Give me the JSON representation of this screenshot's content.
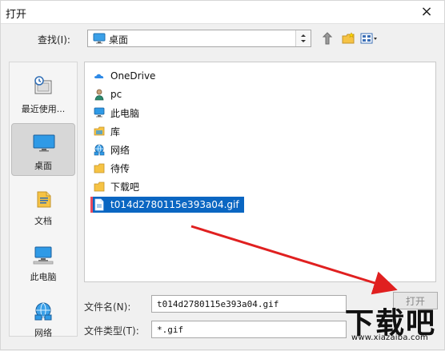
{
  "window": {
    "title": "打开",
    "close_glyph": "×"
  },
  "lookin": {
    "label": "查找(I):",
    "current": "桌面",
    "icon": "desktop-icon",
    "dropdown_icon": "chevron-updown-icon"
  },
  "toolbar": {
    "up_icon": "up-one-level-icon",
    "new_folder_icon": "new-folder-icon",
    "view_menu_icon": "view-menu-icon"
  },
  "sidebar": {
    "items": [
      {
        "label": "最近使用...",
        "icon": "recent-icon"
      },
      {
        "label": "桌面",
        "icon": "desktop-icon",
        "active": true
      },
      {
        "label": "文档",
        "icon": "documents-icon"
      },
      {
        "label": "此电脑",
        "icon": "this-pc-icon"
      },
      {
        "label": "网络",
        "icon": "network-icon"
      }
    ]
  },
  "filelist": {
    "items": [
      {
        "label": "OneDrive",
        "icon": "onedrive-icon"
      },
      {
        "label": "pc",
        "icon": "user-icon"
      },
      {
        "label": "此电脑",
        "icon": "this-pc-icon"
      },
      {
        "label": "库",
        "icon": "libraries-icon"
      },
      {
        "label": "网络",
        "icon": "network-icon"
      },
      {
        "label": "待传",
        "icon": "folder-icon"
      },
      {
        "label": "下载吧",
        "icon": "folder-icon"
      },
      {
        "label": "t014d2780115e393a04.gif",
        "icon": "gif-file-icon",
        "selected": true
      }
    ]
  },
  "fields": {
    "filename_label": "文件名(N):",
    "filename_value": "t014d2780115e393a04.gif",
    "filetype_label": "文件类型(T):",
    "filetype_value": "*.gif",
    "open_button": "打开"
  },
  "watermark": {
    "brand": "下载吧",
    "url": "www.xiazaiba.com"
  },
  "colors": {
    "selection": "#0a66c2",
    "arrow": "#e02020"
  }
}
